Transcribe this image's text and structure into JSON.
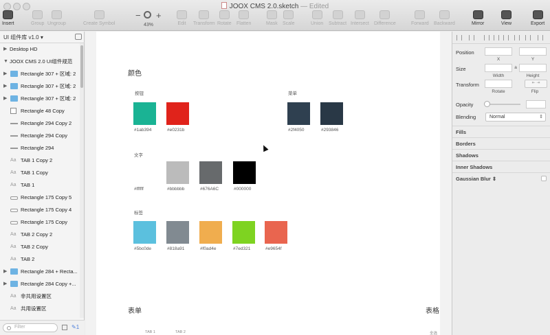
{
  "window": {
    "title": "JOOX CMS 2.0.sketch",
    "edited": "Edited"
  },
  "toolbar": {
    "items": [
      {
        "label": "Insert",
        "icon": "insert-icon",
        "active": true
      },
      {
        "label": "Group",
        "icon": "group-icon",
        "active": false
      },
      {
        "label": "Ungroup",
        "icon": "ungroup-icon",
        "active": false
      },
      {
        "label": "Create Symbol",
        "icon": "create-symbol-icon",
        "active": false
      },
      {
        "label": "Edit",
        "icon": "edit-icon",
        "active": false
      },
      {
        "label": "Transform",
        "icon": "transform-icon",
        "active": false
      },
      {
        "label": "Rotate",
        "icon": "rotate-icon",
        "active": false
      },
      {
        "label": "Flatten",
        "icon": "flatten-icon",
        "active": false
      },
      {
        "label": "Mask",
        "icon": "mask-icon",
        "active": false
      },
      {
        "label": "Scale",
        "icon": "scale-icon",
        "active": false
      },
      {
        "label": "Union",
        "icon": "union-icon",
        "active": false
      },
      {
        "label": "Subtract",
        "icon": "subtract-icon",
        "active": false
      },
      {
        "label": "Intersect",
        "icon": "intersect-icon",
        "active": false
      },
      {
        "label": "Difference",
        "icon": "difference-icon",
        "active": false
      },
      {
        "label": "Forward",
        "icon": "forward-icon",
        "active": false
      },
      {
        "label": "Backward",
        "icon": "backward-icon",
        "active": false
      },
      {
        "label": "Mirror",
        "icon": "mirror-icon",
        "active": true
      },
      {
        "label": "View",
        "icon": "view-icon",
        "active": true
      },
      {
        "label": "Export",
        "icon": "export-icon",
        "active": true
      }
    ],
    "zoom": "43%",
    "zoom_minus": "−",
    "zoom_plus": "+"
  },
  "layers_panel": {
    "page": "UI 组件库 v1.0",
    "filter_placeholder": "Filter",
    "filter_count": "1",
    "items": [
      {
        "label": "Desktop HD",
        "type": "root",
        "disclosure": "▶"
      },
      {
        "label": "JOOX CMS 2.0 UI组件规范",
        "type": "root",
        "disclosure": "▼"
      },
      {
        "label": "Rectangle 307 + 区域: 2",
        "type": "folder",
        "disclosure": "▶"
      },
      {
        "label": "Rectangle 307 + 区域: 2",
        "type": "folder",
        "disclosure": "▶"
      },
      {
        "label": "Rectangle 307 + 区域: 2",
        "type": "folder",
        "disclosure": "▶"
      },
      {
        "label": "Rectangle 48 Copy",
        "type": "rect",
        "disclosure": ""
      },
      {
        "label": "Rectangle 294 Copy 2",
        "type": "line",
        "disclosure": ""
      },
      {
        "label": "Rectangle 294 Copy",
        "type": "line",
        "disclosure": ""
      },
      {
        "label": "Rectangle 294",
        "type": "line",
        "disclosure": ""
      },
      {
        "label": "TAB 1 Copy 2",
        "type": "text",
        "disclosure": ""
      },
      {
        "label": "TAB 1 Copy",
        "type": "text",
        "disclosure": ""
      },
      {
        "label": "TAB 1",
        "type": "text",
        "disclosure": ""
      },
      {
        "label": "Rectangle 175 Copy 5",
        "type": "rrect",
        "disclosure": ""
      },
      {
        "label": "Rectangle 175 Copy 4",
        "type": "rrect",
        "disclosure": ""
      },
      {
        "label": "Rectangle 175 Copy",
        "type": "rrect",
        "disclosure": ""
      },
      {
        "label": "TAB 2 Copy 2",
        "type": "text",
        "disclosure": ""
      },
      {
        "label": "TAB 2 Copy",
        "type": "text",
        "disclosure": ""
      },
      {
        "label": "TAB 2",
        "type": "text",
        "disclosure": ""
      },
      {
        "label": "Rectangle 284 + Recta...",
        "type": "folder",
        "disclosure": "▶"
      },
      {
        "label": "Rectangle 284 Copy +...",
        "type": "folder",
        "disclosure": "▶"
      },
      {
        "label": "非共用设置区",
        "type": "text",
        "disclosure": ""
      },
      {
        "label": "共用设置区",
        "type": "text",
        "disclosure": ""
      }
    ]
  },
  "canvas": {
    "section_colors": "颜色",
    "section_form": "表单",
    "section_table": "表格",
    "groups": {
      "buttons": "按钮",
      "menu": "菜单",
      "text": "文字",
      "tags": "标签"
    },
    "buttons_swatches": [
      {
        "hex": "#1ab394",
        "label": "#1ab394"
      },
      {
        "hex": "#e0231b",
        "label": "#e0231b"
      }
    ],
    "menu_swatches": [
      {
        "hex": "#2f4050",
        "label": "#2f4050"
      },
      {
        "hex": "#293846",
        "label": "#293846"
      }
    ],
    "text_swatches": [
      {
        "hex": "#ffffff",
        "label": "#ffffff"
      },
      {
        "hex": "#bbbbbb",
        "label": "#bbbbbb"
      },
      {
        "hex": "#676a6c",
        "label": "#676A6C"
      },
      {
        "hex": "#000000",
        "label": "#000000"
      }
    ],
    "tag_swatches": [
      {
        "hex": "#5bc0de",
        "label": "#5bc0de"
      },
      {
        "hex": "#818a91",
        "label": "#818a91"
      },
      {
        "hex": "#f0ad4e",
        "label": "#f0ad4e"
      },
      {
        "hex": "#7ed321",
        "label": "#7ed321"
      },
      {
        "hex": "#e9654f",
        "label": "#e9654f"
      }
    ],
    "tab_labels": [
      "TAB 1",
      "TAB 2"
    ],
    "table_corner_label": "全选"
  },
  "inspector": {
    "position": "Position",
    "x": "X",
    "y": "Y",
    "size": "Size",
    "width": "Width",
    "height": "Height",
    "lock": "a",
    "transform": "Transform",
    "rotate": "Rotate",
    "flip": "Flip",
    "opacity": "Opacity",
    "blending": "Blending",
    "blend_value": "Normal",
    "sections": [
      "Fills",
      "Borders",
      "Shadows",
      "Inner Shadows",
      "Gaussian Blur ⇕"
    ]
  }
}
